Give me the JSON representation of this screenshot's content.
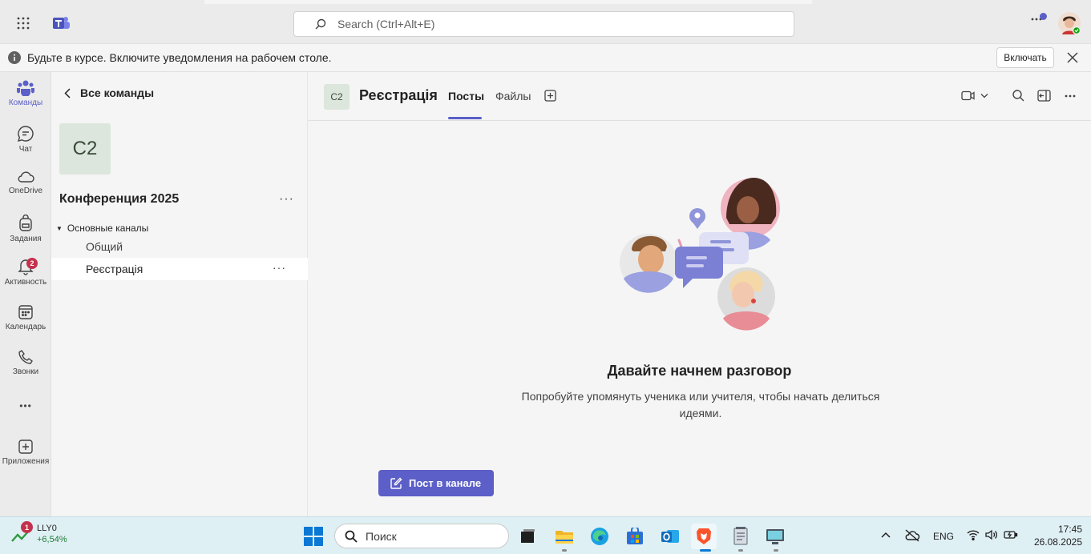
{
  "topbar": {
    "search_placeholder": "Search (Ctrl+Alt+E)"
  },
  "notification": {
    "text": "Будьте в курсе. Включите уведомления на рабочем столе.",
    "button": "Включать"
  },
  "rail": {
    "items": [
      {
        "label": "Команды",
        "icon": "teams-icon"
      },
      {
        "label": "Чат",
        "icon": "chat-icon"
      },
      {
        "label": "OneDrive",
        "icon": "cloud-icon"
      },
      {
        "label": "Задания",
        "icon": "backpack-icon"
      },
      {
        "label": "Активность",
        "icon": "bell-icon",
        "badge": "2"
      },
      {
        "label": "Календарь",
        "icon": "calendar-icon"
      },
      {
        "label": "Звонки",
        "icon": "phone-icon"
      },
      {
        "label": "Приложения",
        "icon": "add-apps-icon"
      }
    ],
    "more": "•••"
  },
  "channels": {
    "back_label": "Все команды",
    "team_avatar": "C2",
    "team_name": "Конференция 2025",
    "team_more": "···",
    "group_label": "Основные каналы",
    "items": [
      {
        "label": "Общий"
      },
      {
        "label": "Реєстрація",
        "more": "···"
      }
    ]
  },
  "main": {
    "channel_avatar": "C2",
    "channel_title": "Реєстрація",
    "tabs": [
      "Посты",
      "Файлы"
    ],
    "active_tab": "Посты",
    "empty_title": "Давайте начнем разговор",
    "empty_subtitle": "Попробуйте упомянуть ученика или учителя, чтобы начать делиться идеями.",
    "post_button": "Пост в канале",
    "accent": "#5b5fc7"
  },
  "taskbar": {
    "stock_symbol": "LLY0",
    "stock_change": "+6,54%",
    "stock_badge": "1",
    "search_placeholder": "Поиск",
    "language": "ENG",
    "time": "17:45",
    "date": "26.08.2025"
  }
}
